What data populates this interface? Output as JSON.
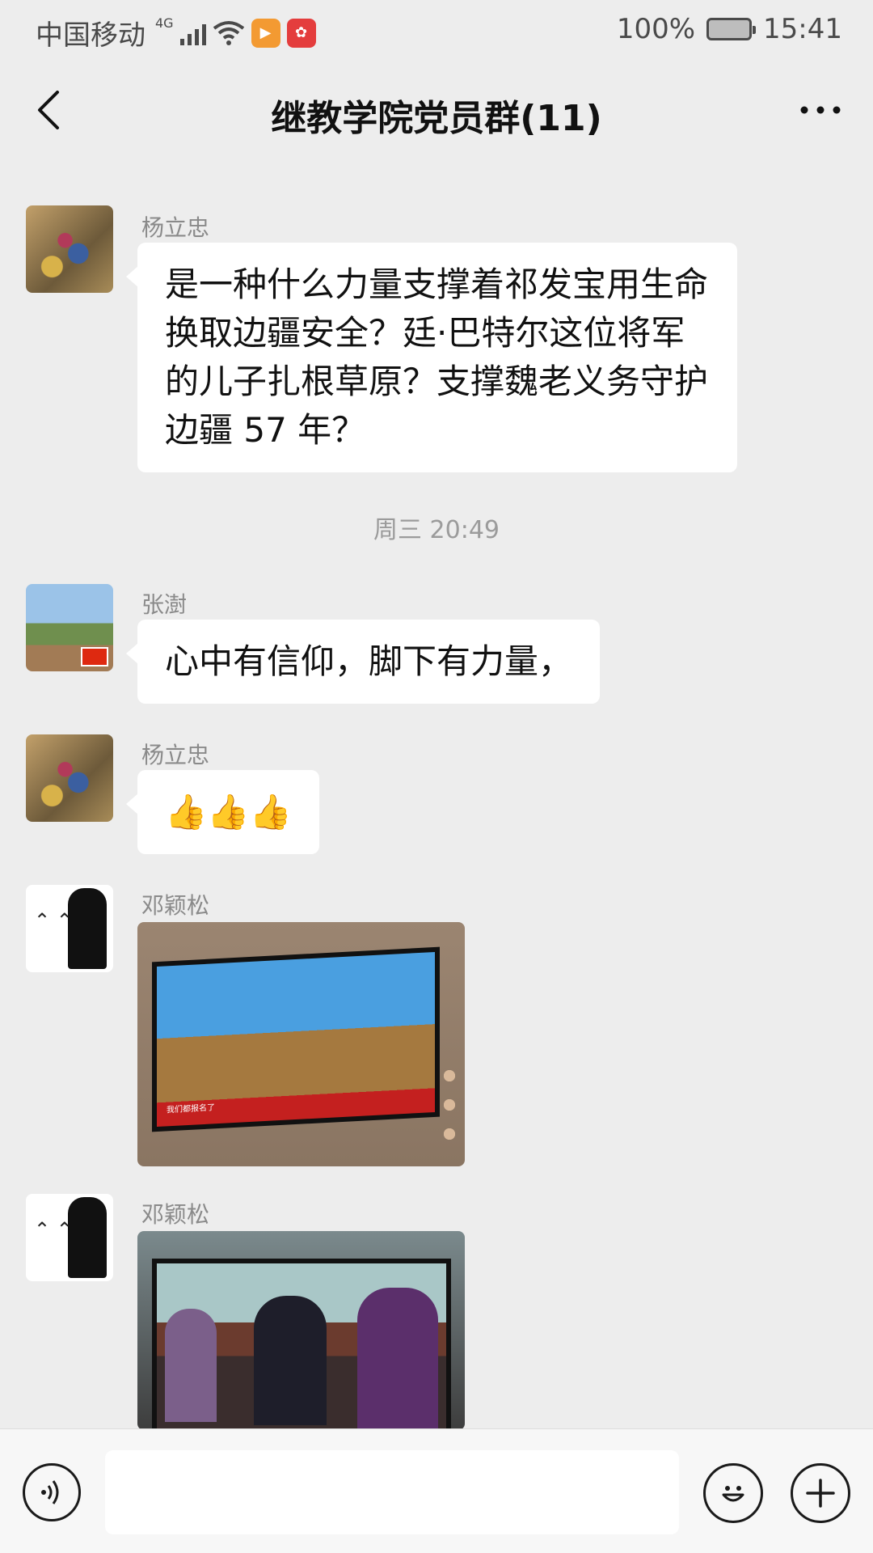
{
  "status_bar": {
    "carrier": "中国移动",
    "network": "4G",
    "battery": "100%",
    "time": "15:41",
    "icons": [
      "signal-icon",
      "wifi-icon",
      "video-app-icon",
      "huawei-app-icon",
      "battery-icon"
    ]
  },
  "header": {
    "title": "继教学院党员群(11)",
    "back_icon": "chevron-left-icon",
    "more_icon": "more-dots-icon"
  },
  "messages": [
    {
      "sender": "杨立忠",
      "text": "是一种什么力量支撑着祁发宝用生命换取边疆安全？廷·巴特尔这位将军的儿子扎根草原？支撑魏老义务守护边疆 57 年？"
    },
    {
      "timestamp": "周三 20:49"
    },
    {
      "sender": "张澍",
      "text": "心中有信仰，脚下有力量，"
    },
    {
      "sender": "杨立忠",
      "text": "👍👍👍"
    },
    {
      "sender": "邓颖松",
      "image_caption": "我们都报名了"
    },
    {
      "sender": "邓颖松"
    }
  ],
  "input_bar": {
    "voice_icon": "voice-icon",
    "emoji_icon": "emoji-icon",
    "plus_icon": "plus-icon"
  }
}
